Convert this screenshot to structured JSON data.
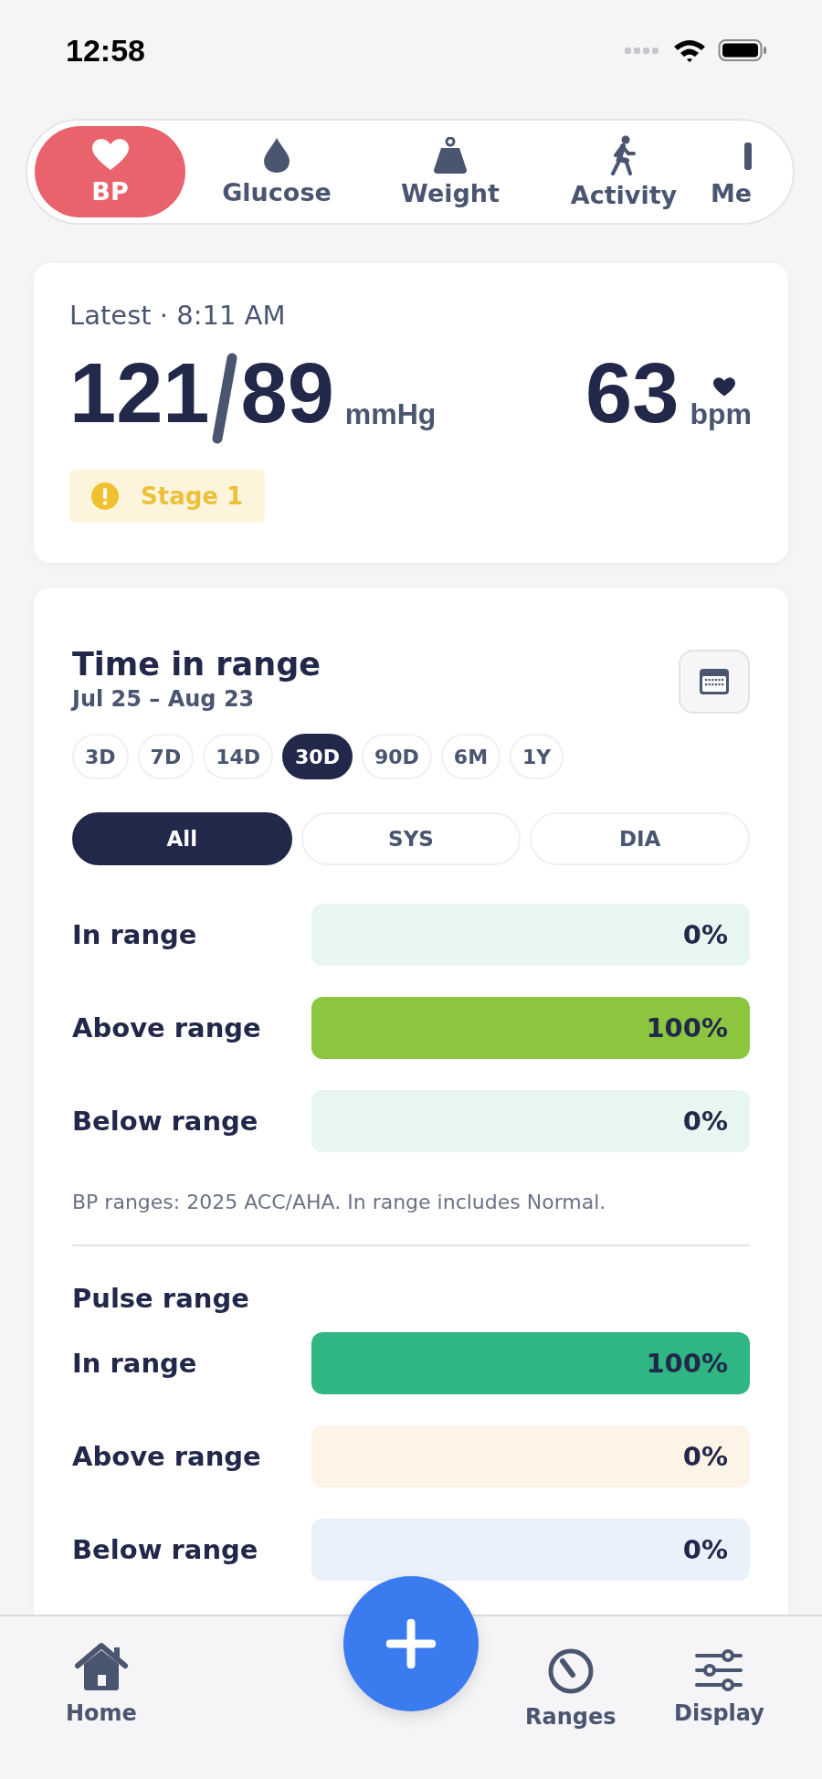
{
  "status_bar": {
    "time": "12:58"
  },
  "tabs": [
    {
      "label": "BP",
      "selected": true
    },
    {
      "label": "Glucose",
      "selected": false
    },
    {
      "label": "Weight",
      "selected": false
    },
    {
      "label": "Activity",
      "selected": false
    },
    {
      "label": "Me",
      "selected": false
    }
  ],
  "latest": {
    "caption": "Latest · 8:11 AM",
    "systolic": "121",
    "diastolic": "89",
    "bp_unit": "mmHg",
    "pulse": "63",
    "pulse_unit": "bpm",
    "badge": "Stage 1"
  },
  "time_in_range": {
    "title": "Time in range",
    "dates": "Jul 25 – Aug 23",
    "periods": [
      {
        "label": "3D",
        "selected": false
      },
      {
        "label": "7D",
        "selected": false
      },
      {
        "label": "14D",
        "selected": false
      },
      {
        "label": "30D",
        "selected": true
      },
      {
        "label": "90D",
        "selected": false
      },
      {
        "label": "6M",
        "selected": false
      },
      {
        "label": "1Y",
        "selected": false
      }
    ],
    "filters": [
      {
        "label": "All",
        "selected": true
      },
      {
        "label": "SYS",
        "selected": false
      },
      {
        "label": "DIA",
        "selected": false
      }
    ],
    "bp_rows": [
      {
        "label": "In range",
        "value": "0%",
        "level": 0,
        "color": "#e7f6f0"
      },
      {
        "label": "Above range",
        "value": "100%",
        "level": 1,
        "color": "#8cc63f"
      },
      {
        "label": "Below range",
        "value": "0%",
        "level": 0,
        "color": "#e7f6f0"
      }
    ],
    "note": "BP ranges: 2025 ACC/AHA. In range includes Normal.",
    "pulse_title": "Pulse range",
    "pulse_rows": [
      {
        "label": "In range",
        "value": "100%",
        "level": 1,
        "color": "#2fb682"
      },
      {
        "label": "Above range",
        "value": "0%",
        "level": 0,
        "color": "#fdf3e6"
      },
      {
        "label": "Below range",
        "value": "0%",
        "level": 0,
        "color": "#eaf1fb"
      }
    ]
  },
  "nav": [
    {
      "label": "Home"
    },
    {
      "label": "Ranges"
    },
    {
      "label": "Display"
    }
  ]
}
